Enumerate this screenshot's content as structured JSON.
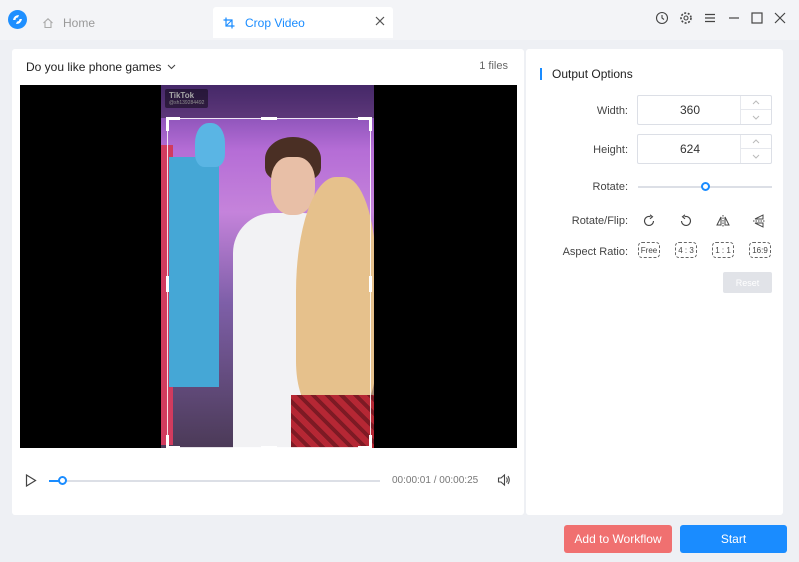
{
  "app": {
    "logo_icon": "app-logo-icon",
    "accent_color": "#1a8cff"
  },
  "tabs": {
    "home_label": "Home",
    "crop_label": "Crop Video"
  },
  "window_controls": [
    "history-icon",
    "gear-icon",
    "menu-icon",
    "minimize-icon",
    "maximize-icon",
    "close-icon"
  ],
  "main": {
    "file_title": "Do you like phone games",
    "file_count": "1 files",
    "watermark_name": "TikTok",
    "watermark_id": "@sh139284492"
  },
  "player": {
    "time": "00:00:01 / 00:00:25",
    "progress_percent": 4
  },
  "options": {
    "title": "Output Options",
    "width_label": "Width:",
    "width_value": "360",
    "height_label": "Height:",
    "height_value": "624",
    "rotate_label": "Rotate:",
    "rotate_slider_percent": 50,
    "rotate_flip_label": "Rotate/Flip:",
    "aspect_label": "Aspect Ratio:",
    "aspect_ratios": [
      "Free",
      "4 : 3",
      "1 : 1",
      "16:9"
    ],
    "reset_label": "Reset"
  },
  "footer": {
    "workflow_label": "Add to Workflow",
    "start_label": "Start",
    "workflow_color": "#f07070"
  }
}
